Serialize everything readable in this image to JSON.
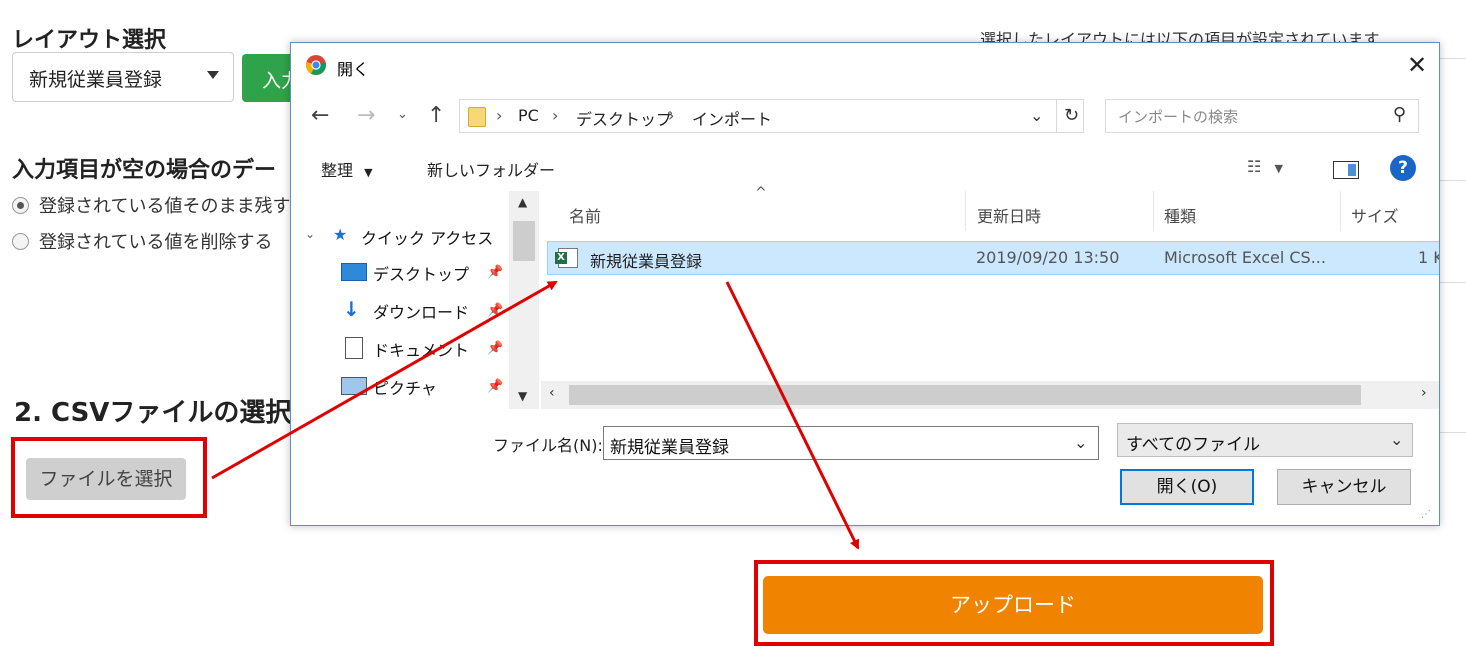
{
  "page": {
    "layout_heading": "レイアウト選択",
    "layout_select_value": "新規従業員登録",
    "green_button_label": "入力",
    "right_note": "選択したレイアウトには以下の項目が設定されています",
    "empty_heading": "入力項目が空の場合のデー",
    "radio_keep": "登録されている値そのまま残す",
    "radio_delete": "登録されている値を削除する",
    "section2_heading": "2. CSVファイルの選択",
    "choose_file_label": "ファイルを選択",
    "upload_label": "アップロード"
  },
  "dialog": {
    "title": "開く",
    "breadcrumbs": [
      "PC",
      "デスクトップ",
      "インポート"
    ],
    "search_placeholder": "インポートの検索",
    "organize_label": "整理",
    "new_folder_label": "新しいフォルダー",
    "nav": {
      "quick_access": "クイック アクセス",
      "items": [
        "デスクトップ",
        "ダウンロード",
        "ドキュメント",
        "ピクチャ"
      ]
    },
    "columns": [
      "名前",
      "更新日時",
      "種類",
      "サイズ"
    ],
    "files": [
      {
        "name": "新規従業員登録",
        "modified": "2019/09/20 13:50",
        "type": "Microsoft Excel CS...",
        "size": "1 K"
      }
    ],
    "filename_label": "ファイル名(N):",
    "filename_value": "新規従業員登録",
    "filetype_value": "すべてのファイル",
    "open_label": "開く(O)",
    "cancel_label": "キャンセル"
  },
  "colors": {
    "highlight_red": "#e00000",
    "upload_orange": "#f08300",
    "green": "#2fa34a",
    "selection_blue": "#cce8ff"
  }
}
